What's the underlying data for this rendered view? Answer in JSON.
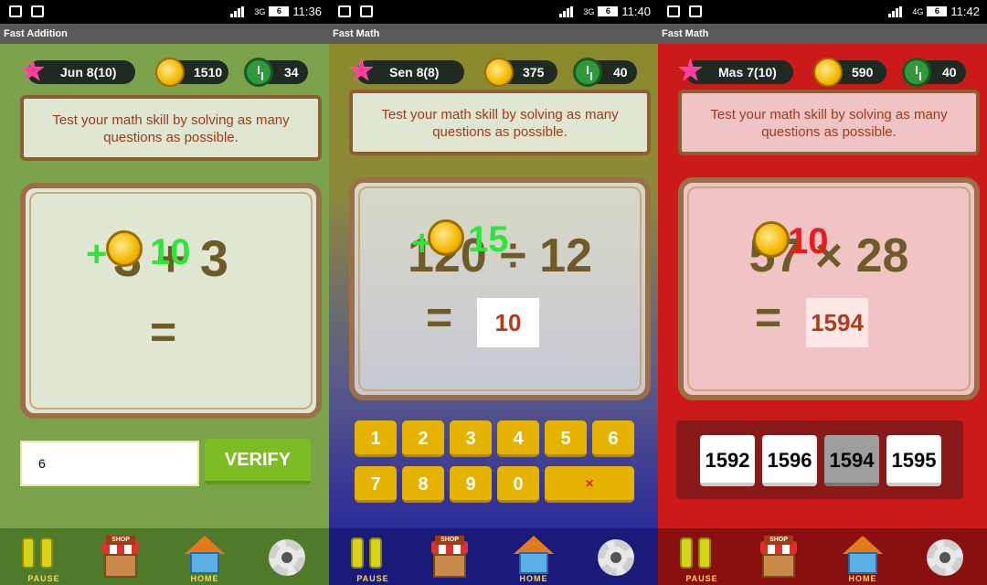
{
  "panels": [
    {
      "status": {
        "network": "3G",
        "battery": "6",
        "time": "11:36"
      },
      "title": "Fast Addition",
      "hud": {
        "level": "Jun 8(10)",
        "coins": "1510",
        "time": "34"
      },
      "info": "Test your math skill by solving as many questions as possible.",
      "question": "3 + 3",
      "equals": "=",
      "bonus": {
        "plus": "+",
        "value": "10"
      },
      "input_value": "6",
      "verify_label": "VERIFY",
      "nav": {
        "pause": "PAUSE",
        "shop": "SHOP",
        "home": "HOME"
      }
    },
    {
      "status": {
        "network": "3G",
        "battery": "6",
        "time": "11:40"
      },
      "title": "Fast Math",
      "hud": {
        "level": "Sen 8(8)",
        "coins": "375",
        "time": "40"
      },
      "info": "Test your math skill by solving as many questions as possible.",
      "question": "120 ÷ 12",
      "equals": "=",
      "answer": "10",
      "bonus": {
        "plus": "+",
        "value": "15"
      },
      "keys": [
        "1",
        "2",
        "3",
        "4",
        "5",
        "6",
        "7",
        "8",
        "9",
        "0",
        "×"
      ],
      "nav": {
        "pause": "PAUSE",
        "shop": "SHOP",
        "home": "HOME"
      }
    },
    {
      "status": {
        "network": "4G",
        "battery": "6",
        "time": "11:42"
      },
      "title": "Fast Math",
      "hud": {
        "level": "Mas 7(10)",
        "coins": "590",
        "time": "40"
      },
      "info": "Test your math skill by solving as many questions as possible.",
      "question": "57 × 28",
      "equals": "=",
      "answer": "1594",
      "bonus": {
        "value": "10"
      },
      "choices": [
        "1592",
        "1596",
        "1594",
        "1595"
      ],
      "selected_choice": "1594",
      "nav": {
        "pause": "PAUSE",
        "shop": "SHOP",
        "home": "HOME"
      }
    }
  ],
  "colors": {
    "panel1_bg": "#7aa24a",
    "panel2_bg": "#8a8a2a",
    "panel3_bg": "#cc1a1a",
    "board_frame": "#9b7048",
    "question_text": "#6e5b2a",
    "verify_green": "#7dbc22",
    "key_yellow": "#e6b400",
    "bonus_green": "#2ee63a",
    "bonus_red": "#ee1a1a"
  },
  "icons": [
    "star-icon",
    "coin-icon",
    "clock-icon",
    "pause-icon",
    "shop-icon",
    "home-icon",
    "gear-icon"
  ]
}
